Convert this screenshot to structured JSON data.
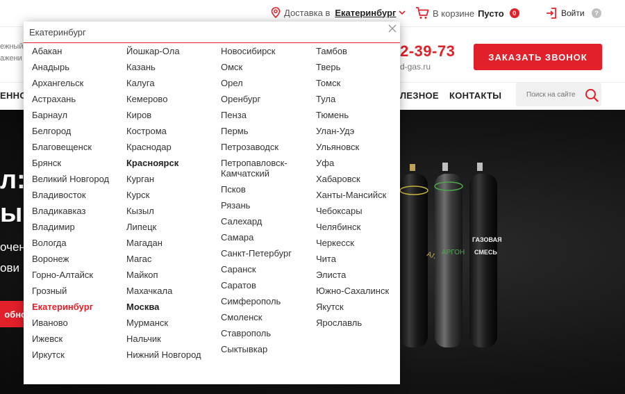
{
  "topbar": {
    "delivery_label": "Доставка в",
    "delivery_city": "Екатеринбург",
    "cart_label": "В корзине",
    "cart_state": "Пусто",
    "cart_count": "0",
    "login_label": "Войти",
    "help_label": "?"
  },
  "header": {
    "tagline_lines": [
      "ежный",
      "ажени"
    ],
    "phone": "2-39-73",
    "email": "d-gas.ru",
    "call_button": "ЗАКАЗАТЬ ЗВОНОК"
  },
  "nav": {
    "items": [
      "ЕННО",
      "ЛЕЗНОЕ",
      "КОНТАКТЫ"
    ],
    "search_placeholder": "Поиск на сайте"
  },
  "hero": {
    "line1": "л: п",
    "line2": "ы р",
    "line3": "очен",
    "line4": "ови",
    "button": "обно"
  },
  "city_picker": {
    "input_value": "Екатеринбург",
    "selected": "Екатеринбург",
    "bold_cities": [
      "Красноярск",
      "Москва"
    ],
    "columns": [
      [
        "Абакан",
        "Анадырь",
        "Архангельск",
        "Астрахань",
        "Барнаул",
        "Белгород",
        "Благовещенск",
        "Брянск",
        "Великий Новгород",
        "Владивосток",
        "Владикавказ",
        "Владимир",
        "Вологда",
        "Воронеж",
        "Горно-Алтайск",
        "Грозный",
        "Екатеринбург",
        "Иваново",
        "Ижевск",
        "Иркутск"
      ],
      [
        "Йошкар-Ола",
        "Казань",
        "Калуга",
        "Кемерово",
        "Киров",
        "Кострома",
        "Краснодар",
        "Красноярск",
        "Курган",
        "Курск",
        "Кызыл",
        "Липецк",
        "Магадан",
        "Магас",
        "Майкоп",
        "Махачкала",
        "Москва",
        "Мурманск",
        "Нальчик",
        "Нижний Новгород"
      ],
      [
        "Новосибирск",
        "Омск",
        "Орел",
        "Оренбург",
        "Пенза",
        "Пермь",
        "Петрозаводск",
        "Петропавловск-Камчатский",
        "Псков",
        "Рязань",
        "Салехард",
        "Самара",
        "Санкт-Петербург",
        "Саранск",
        "Саратов",
        "Симферополь",
        "Смоленск",
        "Ставрополь",
        "Сыктывкар"
      ],
      [
        "Тамбов",
        "Тверь",
        "Томск",
        "Тула",
        "Тюмень",
        "Улан-Удэ",
        "Ульяновск",
        "Уфа",
        "Хабаровск",
        "Ханты-Мансийск",
        "Чебоксары",
        "Челябинск",
        "Черкесск",
        "Чита",
        "Элиста",
        "Южно-Сахалинск",
        "Якутск",
        "Ярославль"
      ]
    ]
  },
  "colors": {
    "accent": "#e2202a",
    "hero_bg": "#141414"
  }
}
